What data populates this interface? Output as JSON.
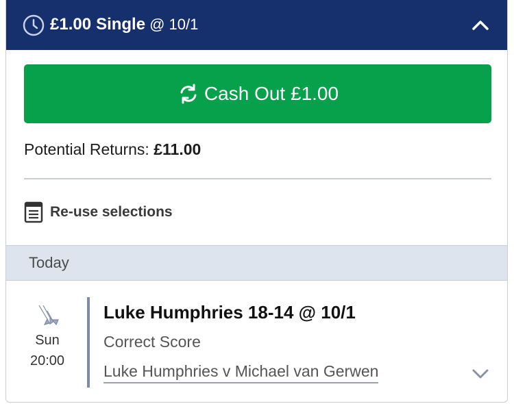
{
  "header": {
    "stake": "£1.00",
    "bet_type": "Single",
    "odds": "@ 10/1",
    "icons": {
      "time": "clock-icon",
      "collapse": "chevron-up-icon"
    }
  },
  "cashout": {
    "label": "Cash Out £1.00",
    "icon": "refresh-icon",
    "color": "#06a14a"
  },
  "returns": {
    "label": "Potential Returns:",
    "value": "£11.00"
  },
  "reuse": {
    "label": "Re-use selections",
    "icon": "document-icon"
  },
  "section": {
    "label": "Today"
  },
  "selection": {
    "sport_icon": "darts-icon",
    "day": "Sun",
    "time": "20:00",
    "title": "Luke Humphries 18-14 @ 10/1",
    "market": "Correct Score",
    "match": "Luke Humphries v Michael van Gerwen",
    "expand_icon": "chevron-down-icon"
  },
  "colors": {
    "header_bg": "#16306e",
    "section_bg": "#dde4ee"
  }
}
